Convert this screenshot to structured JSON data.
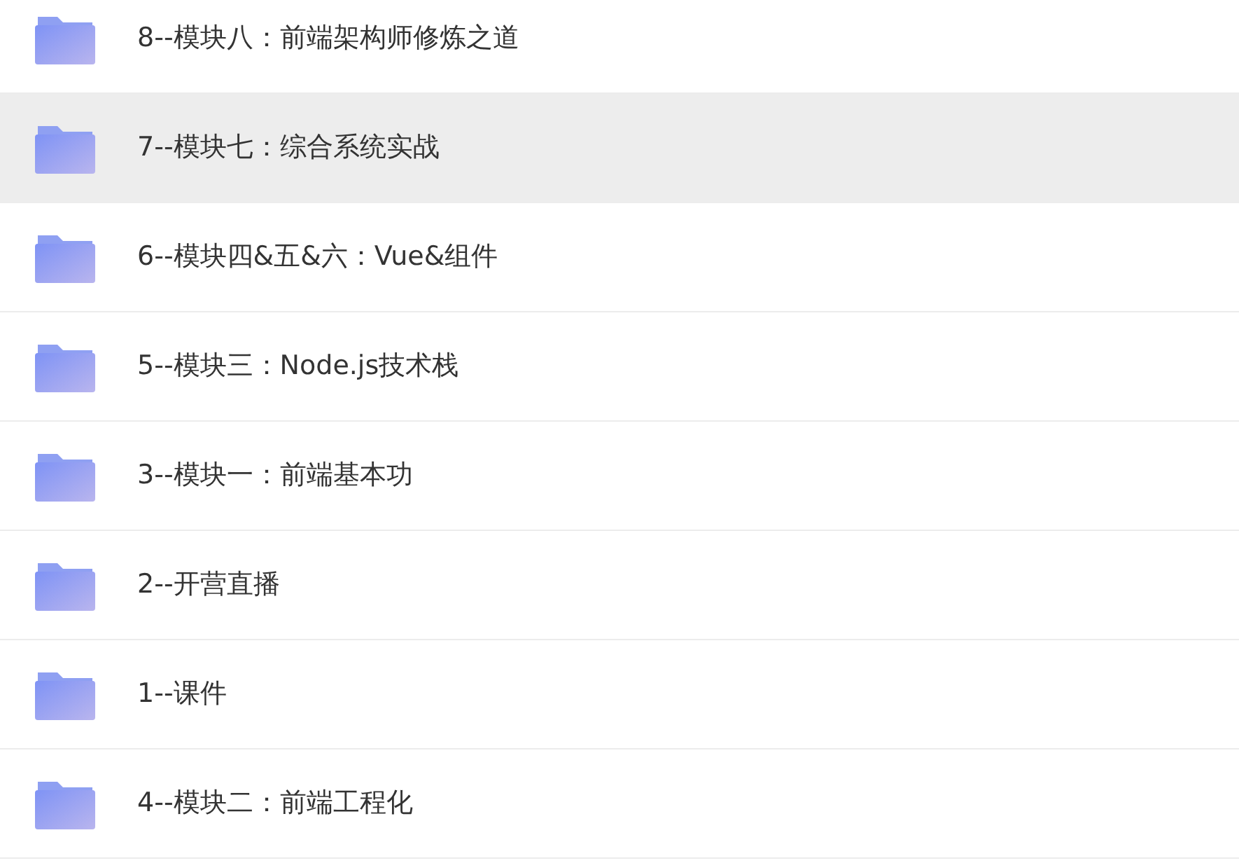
{
  "folders": [
    {
      "name": "8--模块八：前端架构师修炼之道",
      "selected": false
    },
    {
      "name": "7--模块七：综合系统实战",
      "selected": true
    },
    {
      "name": "6--模块四&五&六：Vue&组件",
      "selected": false
    },
    {
      "name": "5--模块三：Node.js技术栈",
      "selected": false
    },
    {
      "name": "3--模块一：前端基本功",
      "selected": false
    },
    {
      "name": "2--开营直播",
      "selected": false
    },
    {
      "name": "1--课件",
      "selected": false
    },
    {
      "name": "4--模块二：前端工程化",
      "selected": false
    }
  ]
}
